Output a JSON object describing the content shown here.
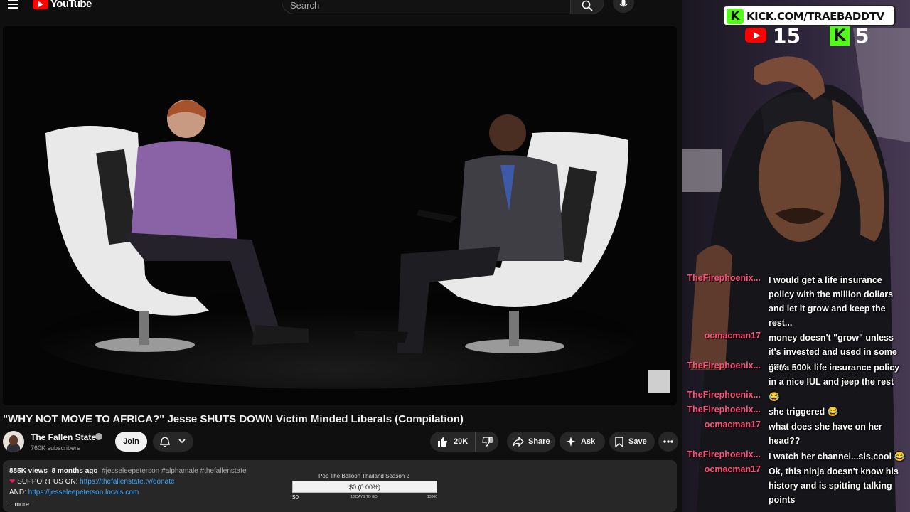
{
  "youtube": {
    "logo_text": "YouTube",
    "search_placeholder": "Search",
    "video_title": "\"WHY NOT MOVE TO AFRICA?\" Jesse SHUTS DOWN Victim Minded Liberals (Compilation)",
    "channel": {
      "name": "The Fallen State",
      "subscribers": "760K subscribers",
      "join_label": "Join"
    },
    "actions": {
      "likes": "20K",
      "share_label": "Share",
      "ask_label": "Ask",
      "save_label": "Save"
    },
    "description": {
      "views": "885K views",
      "date": "8 months ago",
      "tags": "#jesseleepeterson #alphamale #thefallenstate",
      "support_prefix": " SUPPORT US ON: ",
      "support_link": "https://thefallenstate.tv/donate",
      "and_prefix": "AND: ",
      "and_link": "https://jesseleepeterson.locals.com",
      "more_label": "...more"
    }
  },
  "goal_widget": {
    "title": "Pop The Balloon Thailand Season 2",
    "value": "$0 (0.00%)",
    "progress_fraction": 0,
    "min_label": "$0",
    "days_label": "18 DAYS TO GO",
    "max_label": "$3000"
  },
  "stream_overlay": {
    "kick_badge": "K",
    "kick_url": "KICK.COM/TRAEBADDTV",
    "youtube_viewers": "15",
    "kick_viewers": "5",
    "kick_count_badge": "K"
  },
  "chat": [
    {
      "user": "TheFirephoenix...",
      "text": "I would get a life insurance policy with the million dollars and let it grow and keep the rest..."
    },
    {
      "user": "ocmacman17",
      "text": "money doesn't \"grow\" unless it's invested and used in some way."
    },
    {
      "user": "TheFirephoenix...",
      "text": "get a 500k life insurance policy in a nice IUL and jeep the rest"
    },
    {
      "user": "TheFirephoenix...",
      "text": "😂"
    },
    {
      "user": "TheFirephoenix...",
      "text": "she triggered 😂"
    },
    {
      "user": "ocmacman17",
      "text": "what does she have on her head??"
    },
    {
      "user": "TheFirephoenix...",
      "text": "I watch her channel...sis,cool 😂"
    },
    {
      "user": "ocmacman17",
      "text": "Ok, this ninja doesn't know his history and is spitting talking points"
    }
  ],
  "colors": {
    "yt_red": "#ff0000",
    "kick_green": "#53fc18",
    "chat_user": "#ff4f79",
    "link_blue": "#3ea6ff"
  }
}
